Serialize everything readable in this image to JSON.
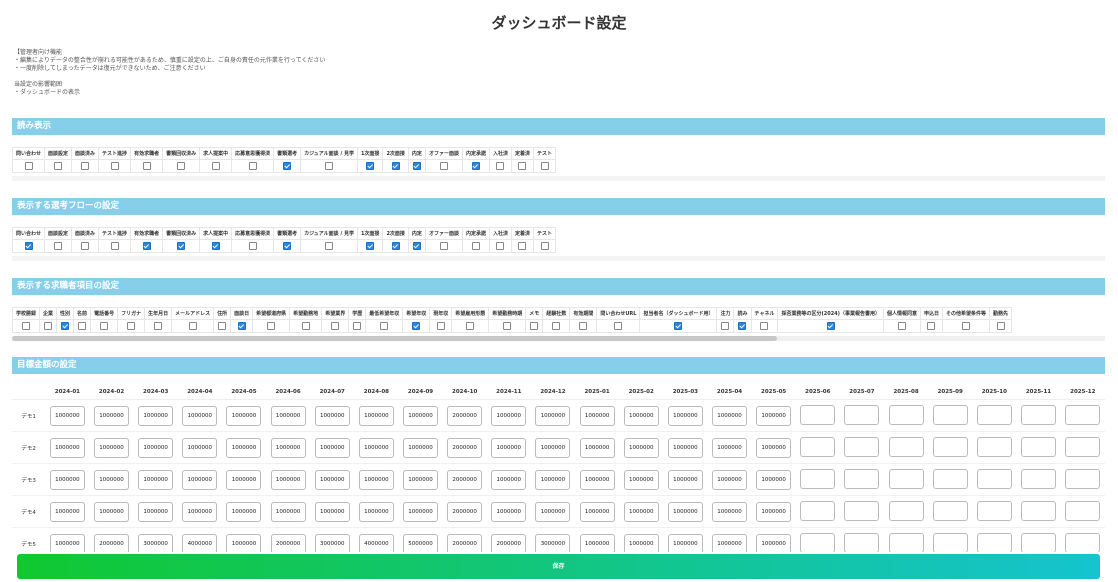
{
  "page": {
    "title": "ダッシュボード設定",
    "notes": [
      "【管理者向け機能",
      "・編集によりデータの整合性が崩れる可能性があるため、慎重に設定の上、ご自身の責任の元作業を行ってください",
      "・一度削除してしまったデータは復元ができないため、ご注意ください",
      "",
      "当設定の影響範囲",
      "・ダッシュボードの表示"
    ]
  },
  "read_section": {
    "title": "読み表示",
    "columns": [
      "問い合わせ",
      "面談設定",
      "面談済み",
      "テスト進捗",
      "有効求職者",
      "書類回収済み",
      "求人提案中",
      "応募意思獲得済",
      "書類選考",
      "カジュアル面談 / 見学",
      "1次面接",
      "2次面接",
      "内定",
      "オファー面談",
      "内定承諾",
      "入社済",
      "定着済",
      "テスト"
    ],
    "checked": [
      false,
      false,
      false,
      false,
      false,
      false,
      false,
      false,
      true,
      false,
      true,
      true,
      true,
      false,
      true,
      false,
      false,
      false
    ]
  },
  "flow_section": {
    "title": "表示する選考フローの設定",
    "columns": [
      "問い合わせ",
      "面談設定",
      "面談済み",
      "テスト進捗",
      "有効求職者",
      "書類回収済み",
      "求人提案中",
      "応募意思獲得済",
      "書類選考",
      "カジュアル面談 / 見学",
      "1次面接",
      "2次面接",
      "内定",
      "オファー面談",
      "内定承諾",
      "入社済",
      "定着済",
      "テスト"
    ],
    "checked": [
      true,
      false,
      false,
      false,
      true,
      true,
      true,
      false,
      true,
      false,
      true,
      true,
      true,
      false,
      false,
      false,
      false,
      false
    ]
  },
  "fields_section": {
    "title": "表示する求職者項目の設定",
    "columns": [
      "学校勝録",
      "企業",
      "性別",
      "名前",
      "電話番号",
      "フリガナ",
      "生年月日",
      "メールアドレス",
      "住所",
      "面談日",
      "希望都道府県",
      "希望勤務地",
      "希望業界",
      "学歴",
      "最低希望年収",
      "希望年収",
      "現年収",
      "希望雇用形態",
      "希望勤務時期",
      "メモ",
      "経験社数",
      "有効期間",
      "問い合わせURL",
      "担当者名（ダッシュボード用）",
      "注力",
      "読み",
      "チャネル",
      "採否業務等の区分(2024)（事業報告書用）",
      "個人情報同意",
      "申込日",
      "その他希望条件等",
      "勤務先"
    ],
    "checked": [
      false,
      false,
      true,
      false,
      false,
      false,
      false,
      false,
      false,
      true,
      false,
      false,
      false,
      false,
      false,
      true,
      false,
      false,
      false,
      false,
      false,
      false,
      false,
      true,
      false,
      true,
      false,
      true,
      false,
      false,
      false,
      false
    ]
  },
  "goal_section": {
    "title": "目標金額の設定",
    "months": [
      "2024-01",
      "2024-02",
      "2024-03",
      "2024-04",
      "2024-05",
      "2024-06",
      "2024-07",
      "2024-08",
      "2024-09",
      "2024-10",
      "2024-11",
      "2024-12",
      "2025-01",
      "2025-02",
      "2025-03",
      "2025-04",
      "2025-05",
      "2025-06",
      "2025-07",
      "2025-08",
      "2025-09",
      "2025-10",
      "2025-11",
      "2025-12"
    ],
    "rows": [
      {
        "label": "デモ1",
        "values": [
          "1000000",
          "1000000",
          "1000000",
          "1000000",
          "1000000",
          "1000000",
          "1000000",
          "1000000",
          "1000000",
          "2000000",
          "1000000",
          "1000000",
          "1000000",
          "1000000",
          "1000000",
          "1000000",
          "1000000",
          "",
          "",
          "",
          "",
          "",
          "",
          ""
        ]
      },
      {
        "label": "デモ2",
        "values": [
          "1000000",
          "1000000",
          "1000000",
          "1000000",
          "1000000",
          "1000000",
          "1000000",
          "1000000",
          "1000000",
          "2000000",
          "1000000",
          "1000000",
          "1000000",
          "1000000",
          "1000000",
          "1000000",
          "1000000",
          "",
          "",
          "",
          "",
          "",
          "",
          ""
        ]
      },
      {
        "label": "デモ3",
        "values": [
          "1000000",
          "1000000",
          "1000000",
          "1000000",
          "1000000",
          "1000000",
          "1000000",
          "1000000",
          "1000000",
          "2000000",
          "1000000",
          "1000000",
          "1000000",
          "1000000",
          "1000000",
          "1000000",
          "1000000",
          "",
          "",
          "",
          "",
          "",
          "",
          ""
        ]
      },
      {
        "label": "デモ4",
        "values": [
          "1000000",
          "1000000",
          "1000000",
          "1000000",
          "1000000",
          "1000000",
          "1000000",
          "1000000",
          "1000000",
          "2000000",
          "1000000",
          "1000000",
          "1000000",
          "1000000",
          "1000000",
          "1000000",
          "1000000",
          "",
          "",
          "",
          "",
          "",
          "",
          ""
        ]
      },
      {
        "label": "デモ5",
        "values": [
          "1000000",
          "2000000",
          "3000000",
          "4000000",
          "1000000",
          "2000000",
          "3000000",
          "4000000",
          "5000000",
          "2000000",
          "2000000",
          "3000000",
          "1000000",
          "1000000",
          "1000000",
          "1000000",
          "1000000",
          "",
          "",
          "",
          "",
          "",
          "",
          ""
        ]
      }
    ]
  },
  "save_button": {
    "label": "保存"
  }
}
